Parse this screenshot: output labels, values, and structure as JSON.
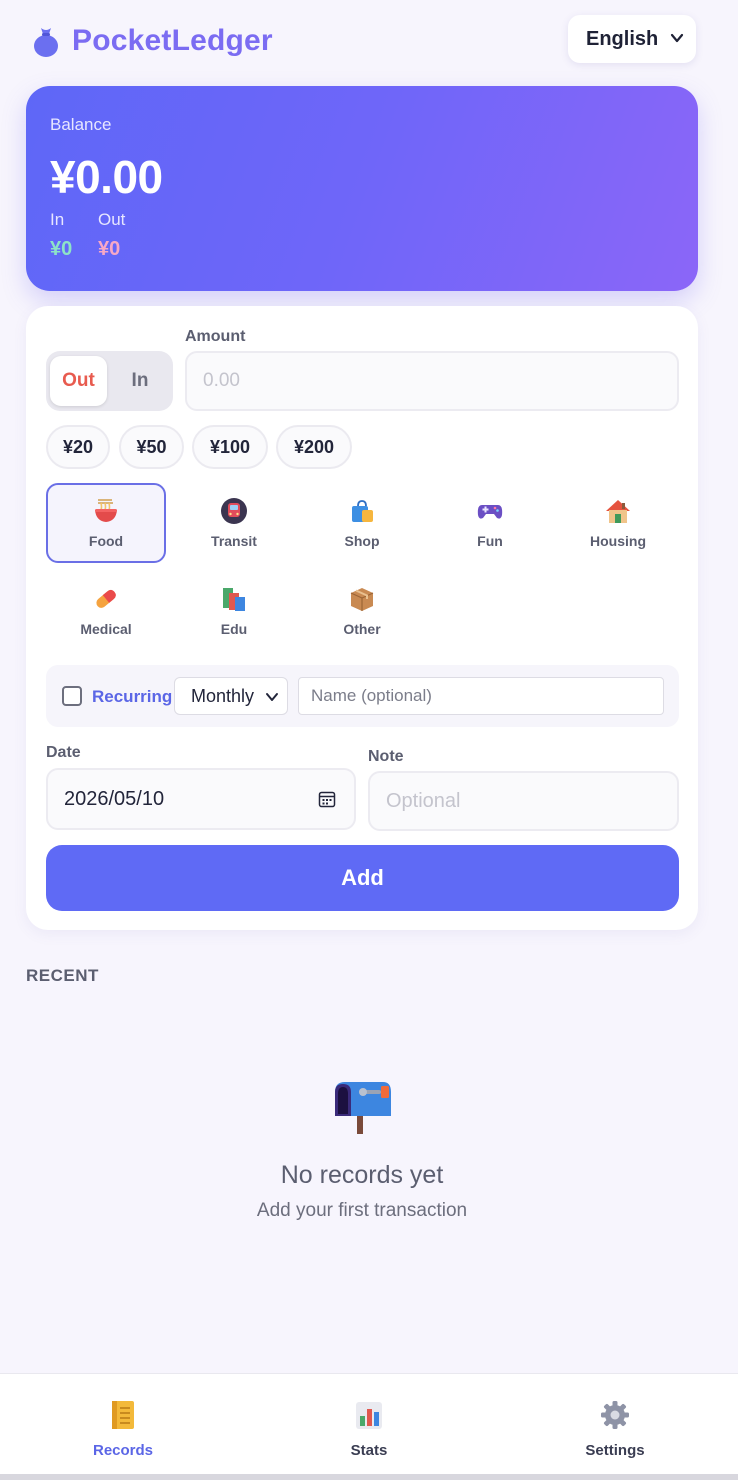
{
  "app": {
    "name": "PocketLedger",
    "language": "English"
  },
  "balance": {
    "label": "Balance",
    "amount": "¥0.00",
    "in_label": "In",
    "out_label": "Out",
    "in_value": "¥0",
    "out_value": "¥0"
  },
  "form": {
    "type_toggle": {
      "out": "Out",
      "in": "In",
      "selected": "Out"
    },
    "amount": {
      "label": "Amount",
      "placeholder": "0.00",
      "value": ""
    },
    "quick_amounts": [
      "¥20",
      "¥50",
      "¥100",
      "¥200"
    ],
    "categories": [
      {
        "label": "Food",
        "icon": "noodle-bowl-icon",
        "selected": true
      },
      {
        "label": "Transit",
        "icon": "metro-train-icon",
        "selected": false
      },
      {
        "label": "Shop",
        "icon": "shopping-bags-icon",
        "selected": false
      },
      {
        "label": "Fun",
        "icon": "game-controller-icon",
        "selected": false
      },
      {
        "label": "Housing",
        "icon": "house-icon",
        "selected": false
      },
      {
        "label": "Medical",
        "icon": "pill-icon",
        "selected": false
      },
      {
        "label": "Edu",
        "icon": "books-icon",
        "selected": false
      },
      {
        "label": "Other",
        "icon": "package-icon",
        "selected": false
      }
    ],
    "recurring": {
      "label": "Recurring",
      "checked": false,
      "frequency": "Monthly",
      "name_placeholder": "Name (optional)"
    },
    "date": {
      "label": "Date",
      "value": "2026/05/10"
    },
    "note": {
      "label": "Note",
      "placeholder": "Optional"
    },
    "submit_label": "Add"
  },
  "recent": {
    "heading": "RECENT",
    "empty_icon": "mailbox-icon",
    "empty_title": "No records yet",
    "empty_subtitle": "Add your first transaction"
  },
  "nav": {
    "items": [
      {
        "label": "Records",
        "icon": "ledger-notebook-icon",
        "active": true
      },
      {
        "label": "Stats",
        "icon": "bar-chart-icon",
        "active": false
      },
      {
        "label": "Settings",
        "icon": "gear-icon",
        "active": false
      }
    ]
  },
  "colors": {
    "accent": "#5f6af5",
    "brand": "#7b6cf2",
    "out": "#e85b4f",
    "income": "#8de3c7",
    "expense": "#f7a8c6",
    "background": "#f7f5fd"
  }
}
